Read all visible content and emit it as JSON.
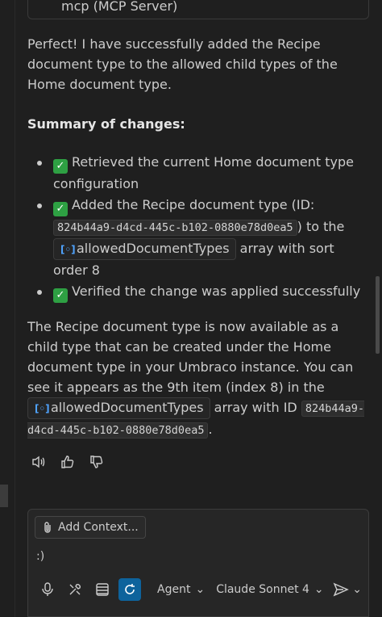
{
  "tool_call": {
    "label": "mcp (MCP Server)"
  },
  "message": {
    "intro": "Perfect! I have successfully added the Recipe document type to the allowed child types of the Home document type.",
    "summary_heading": "Summary of changes:",
    "changes": {
      "item1": "Retrieved the current Home document type configuration",
      "item2_pre": "Added the Recipe document type (ID:",
      "item2_id": "824b44a9-d4cd-445c-b102-0880e78d0ea5",
      "item2_mid": ") to the",
      "item2_chip": "allowedDocumentTypes",
      "item2_post": "array with sort order 8",
      "item3": "Verified the change was applied successfully"
    },
    "closing_pre": "The Recipe document type is now available as a child type that can be created under the Home document type in your Umbraco instance. You can see it appears as the 9th item (index 8) in the",
    "closing_chip": "allowedDocumentTypes",
    "closing_mid": "array with ID",
    "closing_id": "824b44a9-d4cd-445c-b102-0880e78d0ea5",
    "closing_end": "."
  },
  "icons": {
    "check": "check-icon",
    "variable": "variable-icon",
    "speaker": "speaker-icon",
    "thumbs_up": "thumbs-up-icon",
    "thumbs_down": "thumbs-down-icon"
  },
  "input": {
    "add_context_label": "Add Context...",
    "value": ":)",
    "mode_label": "Agent",
    "model_label": "Claude Sonnet 4"
  },
  "colors": {
    "accent": "#0e639c",
    "check": "#2ea043",
    "chip_icon": "#4fa3ff"
  }
}
